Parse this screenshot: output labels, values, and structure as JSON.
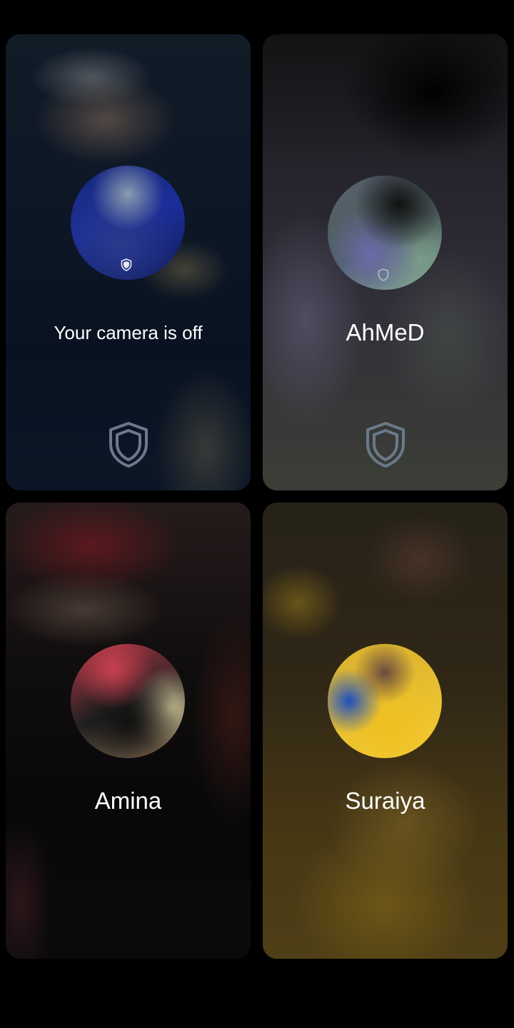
{
  "call_grid": {
    "tiles": [
      {
        "id": "self",
        "label": "Your camera is off",
        "avatar_icon": "profile-photo",
        "badge_icon": "shield-icon"
      },
      {
        "id": "participant-ahmed",
        "label": "AhMeD",
        "avatar_icon": "profile-photo",
        "badge_icon": "shield-icon"
      },
      {
        "id": "participant-amina",
        "label": "Amina",
        "avatar_icon": "profile-photo"
      },
      {
        "id": "participant-suraiya",
        "label": "Suraiya",
        "avatar_icon": "profile-photo"
      }
    ]
  },
  "colors": {
    "background": "#000000",
    "label_text": "#ffffff",
    "shield_stroke": "#6b7a8a"
  }
}
